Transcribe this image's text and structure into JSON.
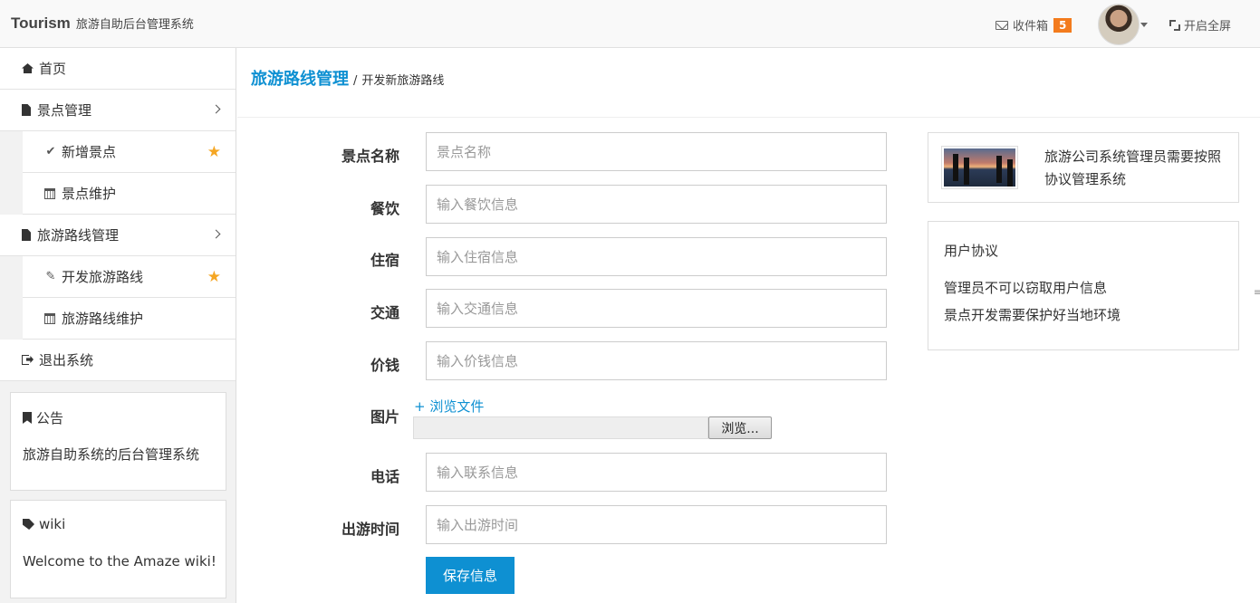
{
  "header": {
    "brand": "Tourism",
    "subtitle": "旅游自助后台管理系统",
    "inbox_label": "收件箱",
    "inbox_count": "5",
    "fullscreen_label": "开启全屏",
    "badge_color": "#F37B1D"
  },
  "sidebar": {
    "items": [
      {
        "label": "首页",
        "icon": "home-icon"
      },
      {
        "label": "景点管理",
        "icon": "file-icon"
      },
      {
        "label": "新增景点",
        "icon": "check-icon"
      },
      {
        "label": "景点维护",
        "icon": "calendar-icon"
      },
      {
        "label": "旅游路线管理",
        "icon": "file-icon"
      },
      {
        "label": "开发旅游路线",
        "icon": "edit-icon"
      },
      {
        "label": "旅游路线维护",
        "icon": "calendar-icon"
      },
      {
        "label": "退出系统",
        "icon": "sign-out-icon"
      }
    ],
    "notice": {
      "title": "公告",
      "body": "旅游自助系统的后台管理系统"
    },
    "wiki": {
      "title": "wiki",
      "body": "Welcome to the Amaze wiki!"
    }
  },
  "breadcrumb": {
    "main": "旅游路线管理",
    "sep": "/",
    "sub": "开发新旅游路线"
  },
  "form": {
    "fields": [
      {
        "label": "景点名称",
        "placeholder": "景点名称"
      },
      {
        "label": "餐饮",
        "placeholder": "输入餐饮信息"
      },
      {
        "label": "住宿",
        "placeholder": "输入住宿信息"
      },
      {
        "label": "交通",
        "placeholder": "输入交通信息"
      },
      {
        "label": "价钱",
        "placeholder": "输入价钱信息"
      },
      {
        "label": "电话",
        "placeholder": "输入联系信息"
      },
      {
        "label": "出游时间",
        "placeholder": "输入出游时间"
      }
    ],
    "image_label": "图片",
    "browse_link": "+ 浏览文件",
    "file_button": "浏览...",
    "save_button": "保存信息",
    "accent_color": "#0e90d2"
  },
  "right": {
    "card1_text": "旅游公司系统管理员需要按照协议管理系统",
    "agreement_title": "用户协议",
    "agreement_lines": [
      "管理员不可以窃取用户信息",
      "景点开发需要保护好当地环境"
    ]
  }
}
